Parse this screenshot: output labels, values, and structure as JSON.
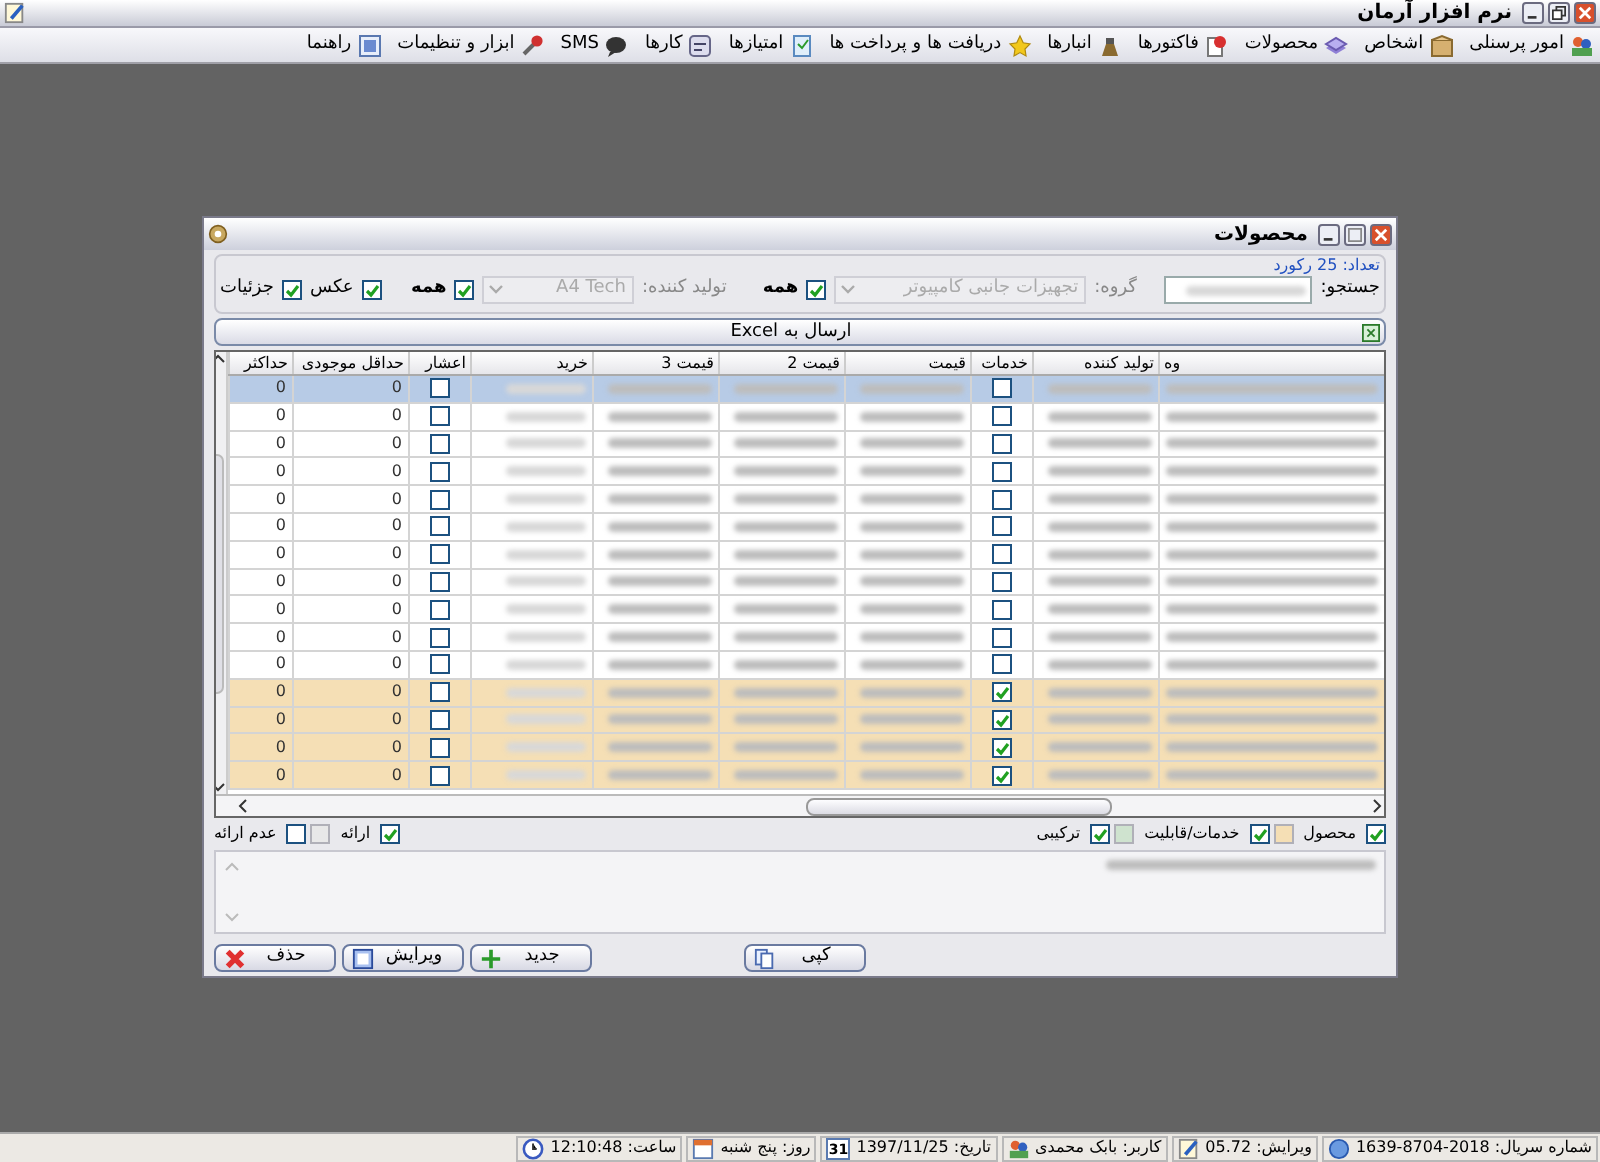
{
  "app": {
    "title": "نرم افزار آرمان"
  },
  "menu": [
    {
      "label": "امور پرسنلی"
    },
    {
      "label": "اشخاص"
    },
    {
      "label": "محصولات"
    },
    {
      "label": "فاکتورها"
    },
    {
      "label": "انبارها"
    },
    {
      "label": "دریافت ها و پرداخت ها"
    },
    {
      "label": "امتیازها"
    },
    {
      "label": "کارها"
    },
    {
      "label": "SMS"
    },
    {
      "label": "ابزار و تنظیمات"
    },
    {
      "label": "راهنما"
    }
  ],
  "dialog": {
    "title": "محصولات",
    "record_count": "تعداد: 25 رکورد",
    "filters": {
      "search_label": "جستجو:",
      "group_label": "گروه:",
      "group_value": "تجهیزات جانبی کامپیوتر",
      "group_disabled": true,
      "group_all": {
        "label": "همه",
        "checked": true
      },
      "maker_label": "تولید کننده:",
      "maker_value": "A4 Tech",
      "maker_disabled": true,
      "maker_all": {
        "label": "همه",
        "checked": true
      },
      "photo": {
        "label": "عکس",
        "checked": true
      },
      "details": {
        "label": "جزئیات",
        "checked": true
      }
    },
    "excel_button": "ارسال به Excel",
    "table": {
      "columns": [
        "وه",
        "تولید کننده",
        "خدمات",
        "قیمت",
        "قیمت 2",
        "قیمت 3",
        "خرید",
        "اعشار",
        "حداقل موجودی",
        "حداکثر"
      ],
      "rows": [
        {
          "selected": true,
          "kind": "product",
          "services": false,
          "decimal": false,
          "min_stock": "0",
          "max": "0"
        },
        {
          "selected": false,
          "kind": "product",
          "services": false,
          "decimal": false,
          "min_stock": "0",
          "max": "0"
        },
        {
          "selected": false,
          "kind": "product",
          "services": false,
          "decimal": false,
          "min_stock": "0",
          "max": "0"
        },
        {
          "selected": false,
          "kind": "product",
          "services": false,
          "decimal": false,
          "min_stock": "0",
          "max": "0"
        },
        {
          "selected": false,
          "kind": "product",
          "services": false,
          "decimal": false,
          "min_stock": "0",
          "max": "0"
        },
        {
          "selected": false,
          "kind": "product",
          "services": false,
          "decimal": false,
          "min_stock": "0",
          "max": "0"
        },
        {
          "selected": false,
          "kind": "product",
          "services": false,
          "decimal": false,
          "min_stock": "0",
          "max": "0"
        },
        {
          "selected": false,
          "kind": "product",
          "services": false,
          "decimal": false,
          "min_stock": "0",
          "max": "0"
        },
        {
          "selected": false,
          "kind": "product",
          "services": false,
          "decimal": false,
          "min_stock": "0",
          "max": "0"
        },
        {
          "selected": false,
          "kind": "product",
          "services": false,
          "decimal": false,
          "min_stock": "0",
          "max": "0"
        },
        {
          "selected": false,
          "kind": "product",
          "services": false,
          "decimal": false,
          "min_stock": "0",
          "max": "0"
        },
        {
          "selected": false,
          "kind": "service",
          "services": true,
          "decimal": false,
          "min_stock": "0",
          "max": "0"
        },
        {
          "selected": false,
          "kind": "service",
          "services": true,
          "decimal": false,
          "min_stock": "0",
          "max": "0"
        },
        {
          "selected": false,
          "kind": "service",
          "services": true,
          "decimal": false,
          "min_stock": "0",
          "max": "0"
        },
        {
          "selected": false,
          "kind": "service",
          "services": true,
          "decimal": false,
          "min_stock": "0",
          "max": "0"
        }
      ]
    },
    "type_legend": [
      {
        "label": "محصول",
        "checked": true
      },
      {
        "label": "خدمات/قابلیت",
        "checked": true,
        "color": "#f5dfb5"
      },
      {
        "label": "ترکیبی",
        "checked": true,
        "color": "#cfe3cf"
      }
    ],
    "offer_legend": [
      {
        "label": "ارائه",
        "checked": true
      },
      {
        "label": "عدم ارائه",
        "checked": false,
        "color": "#e8e8e8"
      }
    ],
    "buttons": [
      {
        "label": "کپی"
      },
      {
        "label": "جدید"
      },
      {
        "label": "ویرایش"
      },
      {
        "label": "حذف"
      }
    ]
  },
  "status_bar": [
    {
      "label": "شماره سریال: 2018-8704-1639"
    },
    {
      "label": "ویرایش: 05.72"
    },
    {
      "label": "کاربر: بابک محمدی"
    },
    {
      "label": "تاریخ: 1397/11/25",
      "icon_text": "31"
    },
    {
      "label": "روز: پنج شنبه"
    },
    {
      "label": "ساعت: 12:10:48"
    }
  ]
}
